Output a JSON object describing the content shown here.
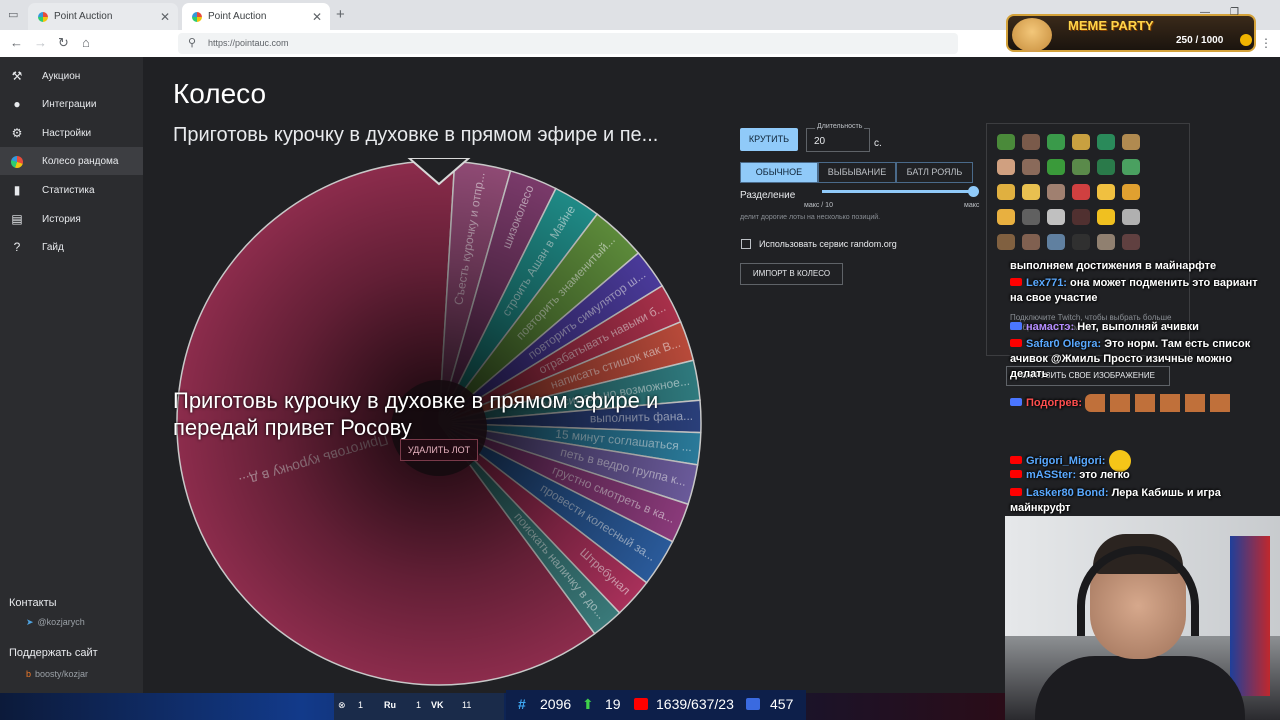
{
  "browser": {
    "tabs": [
      {
        "label": "Point Auction"
      },
      {
        "label": "Point Auction"
      }
    ],
    "new_tab": "+",
    "url": "https://pointauc.com"
  },
  "sidebar": {
    "items": [
      {
        "label": "Аукцион",
        "icon": "gavel-icon"
      },
      {
        "label": "Интеграции",
        "icon": "user-icon"
      },
      {
        "label": "Настройки",
        "icon": "gear-icon"
      },
      {
        "label": "Колесо рандома",
        "icon": "pie-icon"
      },
      {
        "label": "Статистика",
        "icon": "bar-chart-icon"
      },
      {
        "label": "История",
        "icon": "clipboard-icon"
      },
      {
        "label": "Гайд",
        "icon": "help-icon"
      }
    ],
    "contacts_title": "Контакты",
    "telegram": "@kozjarych",
    "support_title": "Поддержать сайт",
    "boosty": "boosty/kozjar"
  },
  "main": {
    "page_title": "Колесо",
    "lot_title": "Приготовь курочку в духовке в прямом эфире и пе...",
    "winner": "Приготовь курочку в духовке в прямом эфире и передай привет Росову",
    "delete_lot": "УДАЛИТЬ ЛОТ"
  },
  "wheel": {
    "segments": [
      {
        "label": "Приготовь курочку в д...",
        "value": 62,
        "color": "#8c2c4c"
      },
      {
        "label": "Съесть курочку и отпр...",
        "value": 3.5,
        "color": "#8f4a74"
      },
      {
        "label": "шизоколесо",
        "value": 3,
        "color": "#7a3a6a"
      },
      {
        "label": "строить Ашан в Майне",
        "value": 3,
        "color": "#1f8a86"
      },
      {
        "label": "повторить знаменитый...",
        "value": 3.5,
        "color": "#5c8a3a"
      },
      {
        "label": "повторить симулятор ш...",
        "value": 2.5,
        "color": "#4a3a9a"
      },
      {
        "label": "отрабатывать навыки б...",
        "value": 2.5,
        "color": "#a8304a"
      },
      {
        "label": "написать стишок как В...",
        "value": 2.5,
        "color": "#b84a3a"
      },
      {
        "label": "максимально возможное...",
        "value": 2.5,
        "color": "#2f7a7e"
      },
      {
        "label": "выполнить фана...",
        "value": 2,
        "color": "#2a3f7a"
      },
      {
        "label": "15 минут соглашаться ...",
        "value": 2,
        "color": "#2a7a9a"
      },
      {
        "label": "петь в ведро группа к...",
        "value": 2.5,
        "color": "#6a5a9a"
      },
      {
        "label": "грустно смотреть в ка...",
        "value": 2.5,
        "color": "#8a3a7a"
      },
      {
        "label": "провести колесный за...",
        "value": 3,
        "color": "#2a5a9a"
      },
      {
        "label": "Штребунал",
        "value": 2.5,
        "color": "#a8305a"
      },
      {
        "label": "поискать наличку в до...",
        "value": 2,
        "color": "#3a7a7a"
      }
    ]
  },
  "controls": {
    "spin": "КРУТИТЬ",
    "duration_label": "Длительность",
    "duration_value": "20",
    "duration_unit": "с.",
    "modes": [
      "ОБЫЧНОЕ",
      "ВЫБЫВАНИЕ",
      "БАТЛ РОЯЛЬ"
    ],
    "split_label": "Разделение",
    "split_min": "макс / 10",
    "split_max": "макс",
    "split_level": 1.0,
    "split_hint": "делит дорогие лоты на несколько позиций.",
    "random_org": "Использовать сервис random.org",
    "import": "ИМПОРТ В КОЛЕСО"
  },
  "image_panel": {
    "twitch_hint": "Подключите Twitch, чтобы выбрать больше изображений в колесе",
    "upload": "ЗАГРУЗИТЬ СВОЕ ИЗОБРАЖЕНИЕ"
  },
  "chat": [
    {
      "platform": "none",
      "nick": "",
      "text": "выполняем достижения в майнарфте"
    },
    {
      "platform": "youtube",
      "nick": "Lex771:",
      "text": "она может подменить это вариант на свое участие"
    },
    {
      "platform": "vk",
      "nick": "намастэ:",
      "text": "Нет, выполняй ачивки"
    },
    {
      "platform": "youtube",
      "nick": "Safar0 Olegra:",
      "text": "Это норм. Там есть список ачивок @Жмиль Просто изичные можно делать"
    },
    {
      "platform": "vk",
      "nick": "Подогрев:",
      "text": ""
    },
    {
      "platform": "youtube",
      "nick": "Grigori_Migori:",
      "text": ""
    },
    {
      "platform": "youtube",
      "nick": "mASSter:",
      "text": "это легко"
    },
    {
      "platform": "youtube",
      "nick": "Lasker80 Bond:",
      "text": "Лера Кабишь и игра майнкруфт"
    }
  ],
  "meme_party": {
    "title": "MEME PARTY",
    "count": "250 / 1000"
  },
  "tray": {
    "items": [
      "1",
      "Ru",
      "1",
      "VK",
      "11"
    ]
  },
  "stats": {
    "hashtag": "2096",
    "up": "19",
    "youtube": "1639/637/23",
    "vk": "457"
  },
  "colors": {
    "accent": "#90caf9",
    "background": "#202124",
    "sidebar": "#2b2c2f"
  }
}
